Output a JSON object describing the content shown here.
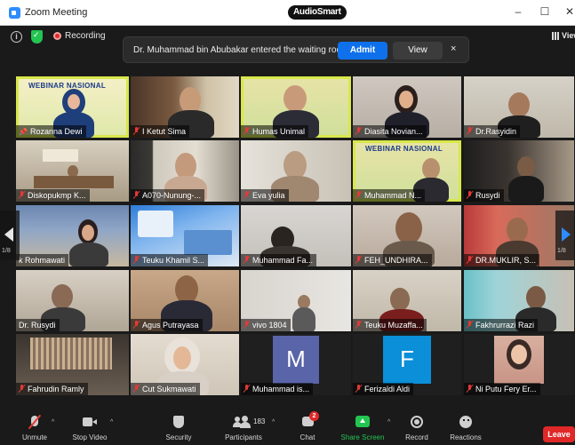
{
  "window": {
    "app_title": "Zoom Meeting",
    "brand": "AudioSmart",
    "minimize": "–",
    "maximize": "☐",
    "close": "✕"
  },
  "topbar": {
    "info_icon": "i",
    "recording_label": "Recording",
    "view_label": "View"
  },
  "notice": {
    "message": "Dr. Muhammad bin Abubakar entered the waiting room",
    "admit_label": "Admit",
    "view_label": "View",
    "close_label": "×"
  },
  "nav": {
    "prev_page": "1/8",
    "next_page": "1/8"
  },
  "banner": {
    "line1": "WEBINAR NASIONAL",
    "line2": "WEBINAR NASIONAL"
  },
  "participants": [
    {
      "name": "Rozanna Dewi"
    },
    {
      "name": "I Ketut Sima"
    },
    {
      "name": "Humas Unimal"
    },
    {
      "name": "Diasita Novian..."
    },
    {
      "name": "Dr.Rasyidin"
    },
    {
      "name": "Diskopukmp K..."
    },
    {
      "name": "A070-Nunung-..."
    },
    {
      "name": "Eva yulia"
    },
    {
      "name": "Muhammad N..."
    },
    {
      "name": "Rusydi"
    },
    {
      "name": "k Rohmawati"
    },
    {
      "name": "Teuku Khamil S..."
    },
    {
      "name": "Muhammad Fa..."
    },
    {
      "name": "FEH_UNDHIRA..."
    },
    {
      "name": "DR.MUKLIR, S..."
    },
    {
      "name": "Dr. Rusydi"
    },
    {
      "name": "Agus Putrayasa"
    },
    {
      "name": "vivo 1804"
    },
    {
      "name": "Teuku Muzaffa..."
    },
    {
      "name": "Fakhrurrazi Razi"
    },
    {
      "name": "Fahrudin Ramly"
    },
    {
      "name": "Cut Sukmawati"
    },
    {
      "name": "Muhammad is...",
      "initial": "M"
    },
    {
      "name": "Ferizaldi Aldi",
      "initial": "F"
    },
    {
      "name": "Ni Putu Fery Er..."
    }
  ],
  "toolbar": {
    "unmute": "Unmute",
    "stop_video": "Stop Video",
    "security": "Security",
    "participants": "Participants",
    "participants_count": "183",
    "chat": "Chat",
    "chat_badge": "2",
    "share_screen": "Share Screen",
    "record": "Record",
    "reactions": "Reactions",
    "leave": "Leave"
  },
  "colors": {
    "accent": "#0e71eb",
    "leave": "#e02828",
    "share": "#23c552",
    "muted": "#e53935"
  }
}
